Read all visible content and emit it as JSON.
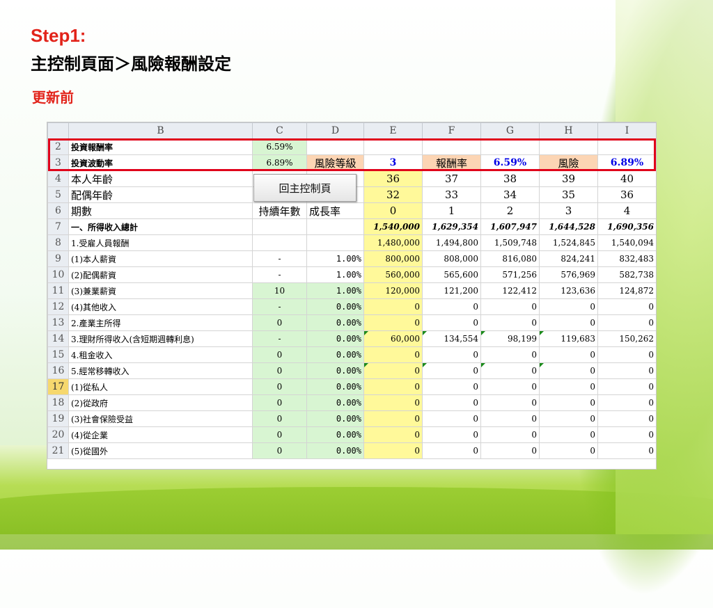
{
  "slide": {
    "step": "Step1:",
    "title": "主控制頁面＞風險報酬設定",
    "subtitle": "更新前"
  },
  "button": {
    "label": "回主控制頁"
  },
  "columns": [
    "B",
    "C",
    "D",
    "E",
    "F",
    "G",
    "H",
    "I"
  ],
  "row2": {
    "num": "2",
    "label": "投資報酬率",
    "c": "6.59%"
  },
  "row3": {
    "num": "3",
    "label": "投資波動率",
    "c": "6.89%",
    "d": "風險等級",
    "e": "3",
    "f": "報酬率",
    "g": "6.59%",
    "h": "風險",
    "i": "6.89%"
  },
  "row4": {
    "num": "4",
    "label": "本人年齡",
    "e": "36",
    "f": "37",
    "g": "38",
    "h": "39",
    "i": "40"
  },
  "row5": {
    "num": "5",
    "label": "配偶年齡",
    "e": "32",
    "f": "33",
    "g": "34",
    "h": "35",
    "i": "36"
  },
  "row6": {
    "num": "6",
    "label": "期數",
    "c": "持續年數",
    "d": "成長率",
    "e": "0",
    "f": "1",
    "g": "2",
    "h": "3",
    "i": "4"
  },
  "rows": [
    {
      "num": "7",
      "label": "一、所得收入總計",
      "c": "",
      "d": "",
      "e": "1,540,000",
      "f": "1,629,354",
      "g": "1,607,947",
      "h": "1,644,528",
      "i": "1,690,356"
    },
    {
      "num": "8",
      "label": "1.受雇人員報酬",
      "c": "",
      "d": "",
      "e": "1,480,000",
      "f": "1,494,800",
      "g": "1,509,748",
      "h": "1,524,845",
      "i": "1,540,094"
    },
    {
      "num": "9",
      "label": "(1)本人薪資",
      "c": "-",
      "d": "1.00%",
      "e": "800,000",
      "f": "808,000",
      "g": "816,080",
      "h": "824,241",
      "i": "832,483"
    },
    {
      "num": "10",
      "label": "(2)配偶薪資",
      "c": "-",
      "d": "1.00%",
      "e": "560,000",
      "f": "565,600",
      "g": "571,256",
      "h": "576,969",
      "i": "582,738"
    },
    {
      "num": "11",
      "label": "(3)兼業薪資",
      "c": "10",
      "d": "1.00%",
      "e": "120,000",
      "f": "121,200",
      "g": "122,412",
      "h": "123,636",
      "i": "124,872"
    },
    {
      "num": "12",
      "label": "(4)其他收入",
      "c": "-",
      "d": "0.00%",
      "e": "0",
      "f": "0",
      "g": "0",
      "h": "0",
      "i": "0"
    },
    {
      "num": "13",
      "label": "2.產業主所得",
      "c": "0",
      "d": "0.00%",
      "e": "0",
      "f": "0",
      "g": "0",
      "h": "0",
      "i": "0"
    },
    {
      "num": "14",
      "label": "3.理財所得收入(含短期週轉利息)",
      "c": "-",
      "d": "0.00%",
      "e": "60,000",
      "f": "134,554",
      "g": "98,199",
      "h": "119,683",
      "i": "150,262"
    },
    {
      "num": "15",
      "label": "4.租金收入",
      "c": "0",
      "d": "0.00%",
      "e": "0",
      "f": "0",
      "g": "0",
      "h": "0",
      "i": "0"
    },
    {
      "num": "16",
      "label": "5.經常移轉收入",
      "c": "0",
      "d": "0.00%",
      "e": "0",
      "f": "0",
      "g": "0",
      "h": "0",
      "i": "0"
    },
    {
      "num": "17",
      "label": "(1)從私人",
      "c": "0",
      "d": "0.00%",
      "e": "0",
      "f": "0",
      "g": "0",
      "h": "0",
      "i": "0"
    },
    {
      "num": "18",
      "label": "(2)從政府",
      "c": "0",
      "d": "0.00%",
      "e": "0",
      "f": "0",
      "g": "0",
      "h": "0",
      "i": "0"
    },
    {
      "num": "19",
      "label": "(3)社會保險受益",
      "c": "0",
      "d": "0.00%",
      "e": "0",
      "f": "0",
      "g": "0",
      "h": "0",
      "i": "0"
    },
    {
      "num": "20",
      "label": "(4)從企業",
      "c": "0",
      "d": "0.00%",
      "e": "0",
      "f": "0",
      "g": "0",
      "h": "0",
      "i": "0"
    },
    {
      "num": "21",
      "label": "(5)從國外",
      "c": "0",
      "d": "0.00%",
      "e": "0",
      "f": "0",
      "g": "0",
      "h": "0",
      "i": "0"
    }
  ],
  "colors": {
    "title_red": "#e2231a",
    "highlight_box": "#e0001a",
    "input_green": "#d8f5d2",
    "current_yellow": "#fff99a",
    "label_orange": "#fcd5b4",
    "value_blue": "#0000e6"
  }
}
